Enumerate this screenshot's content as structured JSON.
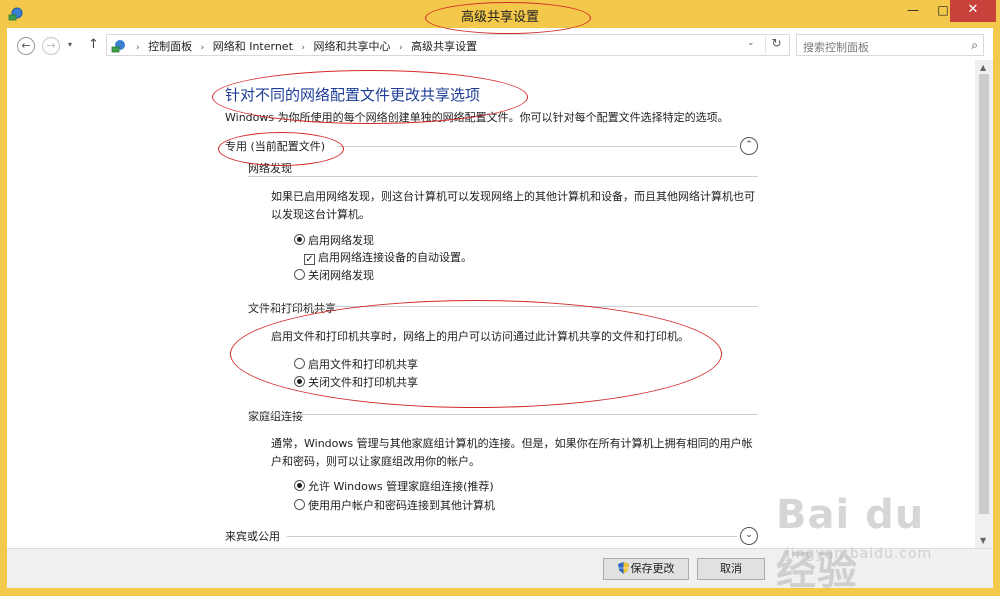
{
  "window": {
    "title": "高级共享设置",
    "minimize_glyph": "—",
    "maximize_glyph": "□",
    "close_glyph": "✕"
  },
  "nav": {
    "back_glyph": "←",
    "forward_glyph": "→",
    "dropdown_glyph": "▾",
    "up_glyph": "↑",
    "breadcrumbs": [
      "控制面板",
      "网络和 Internet",
      "网络和共享中心",
      "高级共享设置"
    ],
    "breadcrumb_sep": "›",
    "address_dropdown_glyph": "⌄",
    "refresh_glyph": "↻",
    "search_placeholder": "搜索控制面板",
    "search_glyph": "⌕"
  },
  "main": {
    "heading": "针对不同的网络配置文件更改共享选项",
    "intro": "Windows 为你所使用的每个网络创建单独的网络配置文件。你可以针对每个配置文件选择特定的选项。",
    "private_profile": {
      "label": "专用 (当前配置文件)",
      "collapse_glyph": "⌃",
      "network_discovery": {
        "title": "网络发现",
        "description": "如果已启用网络发现，则这台计算机可以发现网络上的其他计算机和设备，而且其他网络计算机也可以发现这台计算机。",
        "options": [
          {
            "label": "启用网络发现",
            "selected": true
          },
          {
            "label": "关闭网络发现",
            "selected": false
          }
        ],
        "auto_setup": {
          "label": "启用网络连接设备的自动设置。",
          "checked": true,
          "check_glyph": "✓"
        }
      },
      "file_printer_sharing": {
        "title": "文件和打印机共享",
        "description": "启用文件和打印机共享时，网络上的用户可以访问通过此计算机共享的文件和打印机。",
        "options": [
          {
            "label": "启用文件和打印机共享",
            "selected": false
          },
          {
            "label": "关闭文件和打印机共享",
            "selected": true
          }
        ]
      },
      "homegroup": {
        "title": "家庭组连接",
        "description": "通常，Windows 管理与其他家庭组计算机的连接。但是，如果你在所有计算机上拥有相同的用户帐户和密码，则可以让家庭组改用你的帐户。",
        "options": [
          {
            "label": "允许 Windows 管理家庭组连接(推荐)",
            "selected": true
          },
          {
            "label": "使用用户帐户和密码连接到其他计算机",
            "selected": false
          }
        ]
      }
    },
    "guest_profile": {
      "label": "来宾或公用",
      "expand_glyph": "⌄"
    }
  },
  "footer": {
    "save_label": "保存更改",
    "cancel_label": "取消"
  },
  "watermark": {
    "main": "Bai du 经验",
    "sub": "jingyan.baidu.com"
  },
  "colors": {
    "titlebar": "#f4c84a",
    "close_button": "#c7423b",
    "heading": "#1e3d97",
    "annotation": "#d42a2a"
  }
}
